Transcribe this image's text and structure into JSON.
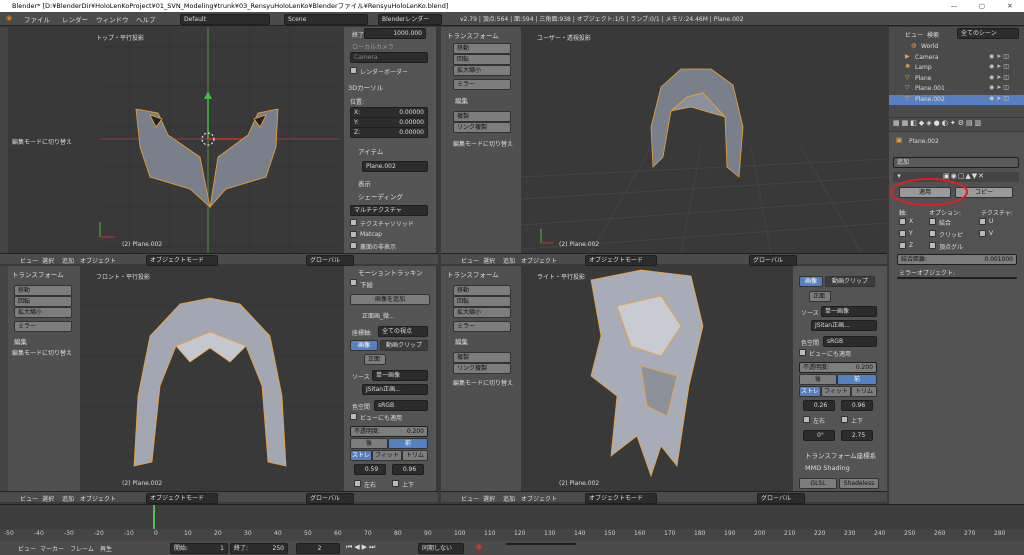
{
  "window": {
    "title": "Blender* [D:¥BlenderDir¥HoloLenKoProject¥01_SVN_Modeling¥trunk¥03_RensyuHoloLenKo¥Blenderファイル¥RensyuHoloLenKo.blend]",
    "minimize": "—",
    "maximize": "▢",
    "close": "✕"
  },
  "menu": {
    "file": "ファイル",
    "render": "レンダー",
    "window": "ウィンドウ",
    "help": "ヘルプ",
    "layout": "Default",
    "scene": "Scene",
    "engine": "Blenderレンダー",
    "stats": "v2.79 | 頂点:564 | 面:594 | 三角面:938 | オブジェクト:1/5 | ランプ:0/1 | メモリ:24.46M | Plane.002"
  },
  "viewports": {
    "top_left": {
      "label": "トップ・平行投影",
      "object": "(2) Plane.002"
    },
    "top_right": {
      "label": "ユーザー・透視投影",
      "object": "(2) Plane.002"
    },
    "bottom_left": {
      "label": "フロント・平行投影",
      "object": "(2) Plane.002"
    },
    "bottom_right": {
      "label": "ライト・平行投影",
      "object": "(2) Plane.002"
    }
  },
  "vp_header": {
    "view": "ビュー",
    "select": "選択",
    "add": "追加",
    "object": "オブジェクト",
    "mode": "オブジェクトモード",
    "global": "グローバル"
  },
  "toolshelf": {
    "transform": "トランスフォーム",
    "move": "移動",
    "rotate": "回転",
    "scale": "拡大縮小",
    "mirror": "ミラー",
    "edit": "編集",
    "duplicate": "複製",
    "link_dup": "リンク複製",
    "edit_mode": "編集モードに切り替え"
  },
  "props_top": {
    "end_label": "終了:",
    "end_value": "1000.000",
    "local_camera": "ローカルカメラ",
    "camera": "Camera",
    "render_border": "レンダーボーダー",
    "cursor_3d": "3Dカーソル",
    "location": "位置:",
    "x_label": "X:",
    "x_val": "0.00000",
    "y_label": "Y:",
    "y_val": "0.00000",
    "z_label": "Z:",
    "z_val": "0.00000",
    "item": "アイテム",
    "item_name": "Plane.002",
    "display": "表示",
    "shading": "シェーディング",
    "multitexture": "マルチテクスチャ",
    "texture_solid": "テクスチャソリッド",
    "matcap": "Matcap",
    "backface": "裏面の非表示"
  },
  "props_bl": {
    "motion": "モーショントラッキン",
    "background": "下絵",
    "add_image": "画像を追加",
    "front_image": "正面画_微...",
    "axis_label": "座標軸:",
    "axis_value": "全ての視点",
    "image": "画像",
    "movie": "動画クリップ",
    "front": "正面",
    "source": "ソース",
    "single": "単一画像",
    "file": "JSitan正画...",
    "colorspace_lbl": "色空間",
    "colorspace": "sRGB",
    "view_also": "ビューにも適用",
    "opacity_lbl": "不透明度:",
    "opacity": "0.200",
    "back": "後",
    "front_btn": "前",
    "stretch": "ストレ",
    "fit": "フィット",
    "crop": "トリム",
    "v1": "0.59",
    "v2": "0.96",
    "lr": "左右",
    "ud": "上下"
  },
  "props_br": {
    "image": "画像",
    "movie": "動画クリップ",
    "front": "正面",
    "source": "ソース",
    "single": "単一画像",
    "file": "JSitan正画...",
    "colorspace_lbl": "色空間",
    "colorspace": "sRGB",
    "view_also": "ビューにも適用",
    "opacity_lbl": "不透明度:",
    "opacity": "0.200",
    "back": "後",
    "front_btn": "前",
    "stretch": "ストレ",
    "fit": "フィット",
    "crop": "トリム",
    "v1": "0.26",
    "v2": "0.96",
    "lr": "左右",
    "ud": "上下",
    "angle1": "0°",
    "angle2": "2.75",
    "transform_coords": "トランスフォーム座標系",
    "mmd": "MMD Shading",
    "glsl": "GLSL",
    "shadeless": "Shadeless"
  },
  "outliner": {
    "view": "ビュー",
    "search": "検索",
    "all_scenes": "全てのシーン",
    "items": [
      "World",
      "Camera",
      "Lamp",
      "Plane",
      "Plane.001",
      "Plane.002"
    ]
  },
  "modifier": {
    "object": "Plane.002",
    "add": "追加",
    "apply": "適用",
    "copy": "コピー",
    "axis": "軸:",
    "options": "オプション:",
    "texture": "テクスチャ:",
    "x": "X",
    "y": "Y",
    "z": "Z",
    "merge": "結合",
    "clip": "クリッピ",
    "vgroup": "頂点グル",
    "u": "U",
    "v": "V",
    "merge_limit": "結合距離:",
    "merge_value": "0.001000",
    "mirror_obj": "ミラーオブジェクト:"
  },
  "timeline": {
    "ticks": [
      "-50",
      "-40",
      "-30",
      "-20",
      "-10",
      "0",
      "10",
      "20",
      "30",
      "40",
      "50",
      "60",
      "70",
      "80",
      "90",
      "100",
      "110",
      "120",
      "130",
      "140",
      "150",
      "160",
      "170",
      "180",
      "190",
      "200",
      "210",
      "220",
      "230",
      "240",
      "250",
      "260",
      "270",
      "280"
    ],
    "view": "ビュー",
    "marker": "マーカー",
    "frame": "フレーム",
    "playback": "再生",
    "start_lbl": "開始:",
    "start": "1",
    "end_lbl": "終了:",
    "end": "250",
    "current": "2",
    "sync": "同期しない"
  },
  "colors": {
    "accent": "#5680c2",
    "bg": "#393939",
    "selected": "#f0a030",
    "annotation": "#e02020"
  }
}
